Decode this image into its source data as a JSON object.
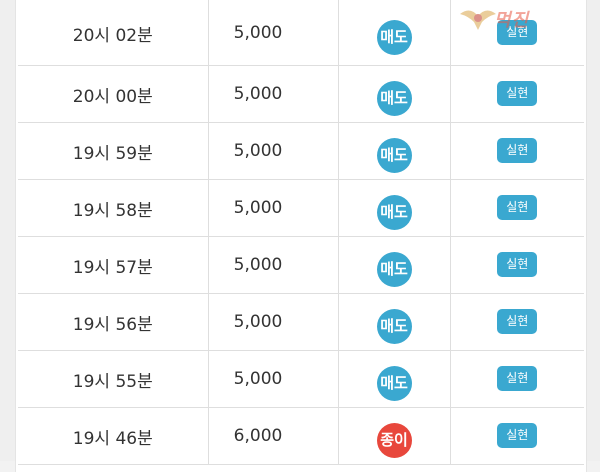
{
  "colors": {
    "sell_badge": "#3aa8d0",
    "paper_badge": "#e8473c",
    "status_button": "#3aa8d0"
  },
  "rows": [
    {
      "time": "20시 02분",
      "amount": "5,000",
      "type": "매도",
      "status": "실현"
    },
    {
      "time": "20시 00분",
      "amount": "5,000",
      "type": "매도",
      "status": "실현"
    },
    {
      "time": "19시 59분",
      "amount": "5,000",
      "type": "매도",
      "status": "실현"
    },
    {
      "time": "19시 58분",
      "amount": "5,000",
      "type": "매도",
      "status": "실현"
    },
    {
      "time": "19시 57분",
      "amount": "5,000",
      "type": "매도",
      "status": "실현"
    },
    {
      "time": "19시 56분",
      "amount": "5,000",
      "type": "매도",
      "status": "실현"
    },
    {
      "time": "19시 55분",
      "amount": "5,000",
      "type": "매도",
      "status": "실현"
    },
    {
      "time": "19시 46분",
      "amount": "6,000",
      "type": "종이",
      "status": "실현"
    }
  ],
  "watermark": {
    "text": "먹진",
    "icon": "wing-logo-icon"
  }
}
